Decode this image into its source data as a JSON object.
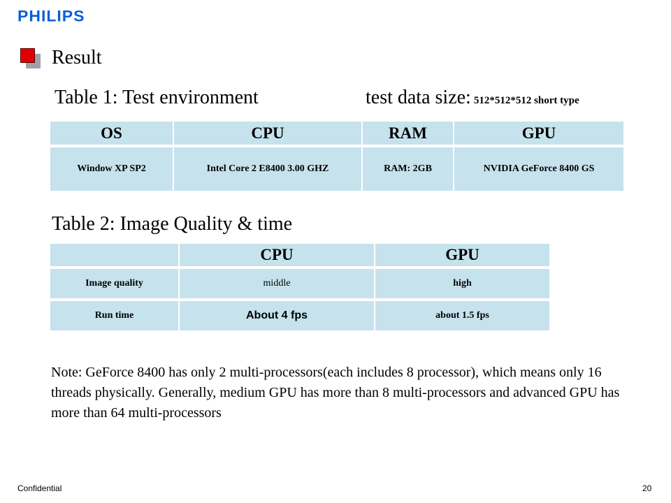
{
  "brand": "PHILIPS",
  "bullet_colors": {
    "front": "#e00000",
    "back": "#9ea2ad"
  },
  "section_title": "Result",
  "table1": {
    "title": "Table 1: Test environment",
    "size_label": "test data size:",
    "size_value": "512*512*512 short type",
    "headers": [
      "OS",
      "CPU",
      "RAM",
      "GPU"
    ],
    "row": [
      "Window XP SP2",
      "Intel Core 2 E8400 3.00 GHZ",
      "RAM: 2GB",
      "NVIDIA GeForce 8400 GS"
    ]
  },
  "table2": {
    "title": "Table 2: Image Quality & time",
    "headers": [
      "",
      "CPU",
      "GPU"
    ],
    "rows": [
      [
        "Image quality",
        "middle",
        "high"
      ],
      [
        "Run time",
        "About 4 fps",
        "about 1.5 fps"
      ]
    ]
  },
  "note": "Note: GeForce 8400 has only 2 multi-processors(each includes 8 processor), which means only 16 threads physically. Generally, medium GPU has more than 8 multi-processors and advanced GPU has more than 64 multi-processors",
  "footer": {
    "left": "Confidential",
    "page_number": "20"
  },
  "table_cell_color": "#c6e2ec"
}
